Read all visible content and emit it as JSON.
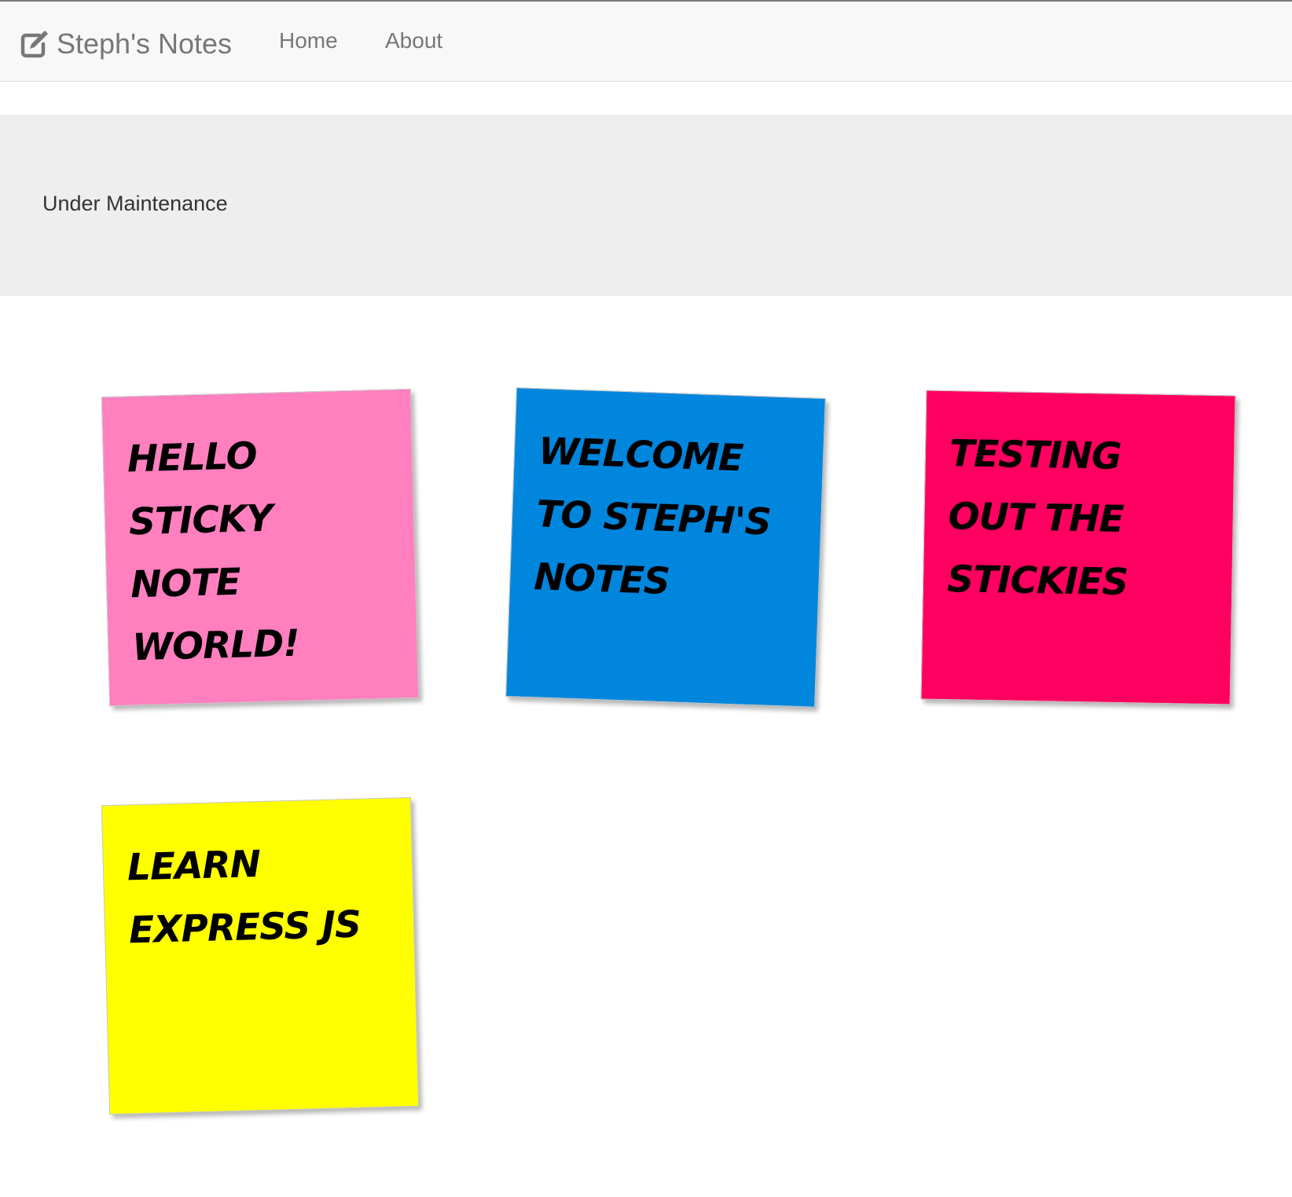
{
  "navbar": {
    "brand": {
      "icon": "edit-icon",
      "title": "Steph's Notes"
    },
    "links": [
      {
        "label": "Home"
      },
      {
        "label": "About"
      }
    ]
  },
  "jumbotron": {
    "text": "Under Maintenance"
  },
  "notes": [
    {
      "text": "hello sticky note world!",
      "color": "#ff7fbf"
    },
    {
      "text": "Welcome to Steph's notes",
      "color": "#0086dd"
    },
    {
      "text": "Testing out the stickies",
      "color": "#ff0060"
    },
    {
      "text": "Learn express js",
      "color": "#ffff00"
    }
  ],
  "colors": {
    "navbar_bg": "#f8f8f8",
    "navbar_text": "#777777",
    "jumbotron_bg": "#eeeeee",
    "jumbotron_text": "#333333"
  }
}
